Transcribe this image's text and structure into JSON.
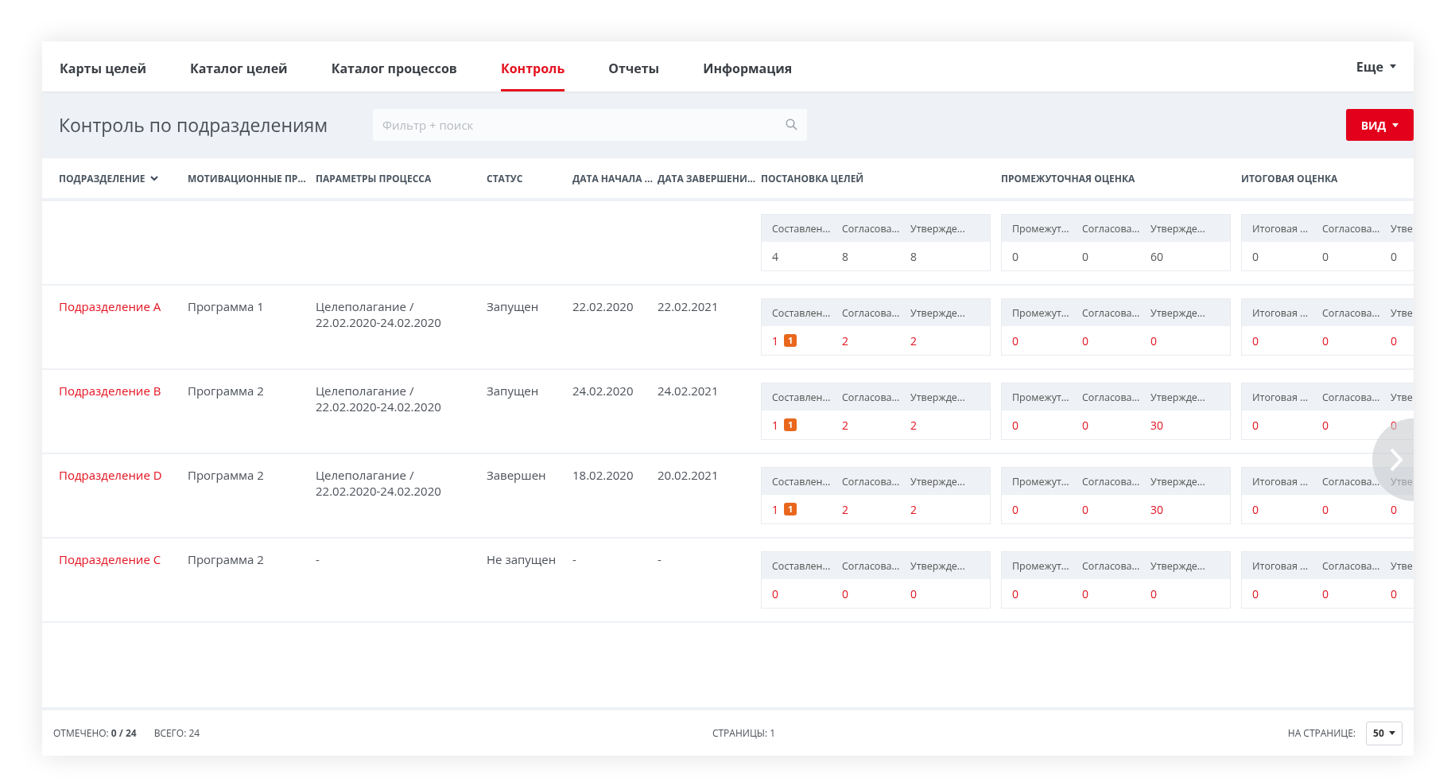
{
  "tabs": [
    {
      "label": "Карты целей",
      "selected": false
    },
    {
      "label": "Каталог целей",
      "selected": false
    },
    {
      "label": "Каталог процессов",
      "selected": false
    },
    {
      "label": "Контроль",
      "selected": true
    },
    {
      "label": "Отчеты",
      "selected": false
    },
    {
      "label": "Информация",
      "selected": false
    }
  ],
  "more_menu": "Еще",
  "title": "Контроль по подразделениям",
  "search": {
    "placeholder": "Фильтр + поиск"
  },
  "view_button": "ВИД",
  "columns": [
    {
      "label": "ПОДРАЗДЕЛЕНИЕ",
      "sorted": true
    },
    {
      "label": "МОТИВАЦИОННЫЕ ПР...",
      "sorted": false
    },
    {
      "label": "ПАРАМЕТРЫ ПРОЦЕССА",
      "sorted": false
    },
    {
      "label": "СТАТУС",
      "sorted": false
    },
    {
      "label": "ДАТА НАЧАЛА ...",
      "sorted": false
    },
    {
      "label": "ДАТА ЗАВЕРШЕНИ...",
      "sorted": false
    },
    {
      "label": "ПОСТАНОВКА ЦЕЛЕЙ",
      "sorted": false
    },
    {
      "label": "ПРОМЕЖУТОЧНАЯ ОЦЕНКА",
      "sorted": false
    },
    {
      "label": "ИТОГОВАЯ ОЦЕНКА",
      "sorted": false
    }
  ],
  "summary": [
    {
      "headers": [
        "Составлен...",
        "Согласова...",
        "Утвержде..."
      ],
      "values": [
        {
          "text": "4"
        },
        {
          "text": "8"
        },
        {
          "text": "8"
        }
      ]
    },
    {
      "headers": [
        "Промежут...",
        "Согласова...",
        "Утвержде..."
      ],
      "values": [
        {
          "text": "0"
        },
        {
          "text": "0"
        },
        {
          "text": "60"
        }
      ]
    },
    {
      "headers": [
        "Итоговая ...",
        "Согласова...",
        "Утве"
      ],
      "values": [
        {
          "text": "0"
        },
        {
          "text": "0"
        },
        {
          "text": "0"
        }
      ]
    }
  ],
  "rows": [
    {
      "division": "Подразделение A",
      "program": "Программа 1",
      "params": [
        "Целеполагание /",
        "22.02.2020-24.02.2020"
      ],
      "status": "Запущен",
      "start": "22.02.2020",
      "end": "22.02.2021",
      "groups": [
        {
          "headers": [
            "Составлен...",
            "Согласова...",
            "Утвержде..."
          ],
          "values": [
            {
              "text": "1",
              "badge": "1"
            },
            {
              "text": "2"
            },
            {
              "text": "2"
            }
          ]
        },
        {
          "headers": [
            "Промежут...",
            "Согласова...",
            "Утвержде..."
          ],
          "values": [
            {
              "text": "0"
            },
            {
              "text": "0"
            },
            {
              "text": "0"
            }
          ]
        },
        {
          "headers": [
            "Итоговая ...",
            "Согласова...",
            "Утве"
          ],
          "values": [
            {
              "text": "0"
            },
            {
              "text": "0"
            },
            {
              "text": "0"
            }
          ]
        }
      ]
    },
    {
      "division": "Подразделение B",
      "program": "Программа 2",
      "params": [
        "Целеполагание /",
        "22.02.2020-24.02.2020"
      ],
      "status": "Запущен",
      "start": "24.02.2020",
      "end": "24.02.2021",
      "groups": [
        {
          "headers": [
            "Составлен...",
            "Согласова...",
            "Утвержде..."
          ],
          "values": [
            {
              "text": "1",
              "badge": "1"
            },
            {
              "text": "2"
            },
            {
              "text": "2"
            }
          ]
        },
        {
          "headers": [
            "Промежут...",
            "Согласова...",
            "Утвержде..."
          ],
          "values": [
            {
              "text": "0"
            },
            {
              "text": "0"
            },
            {
              "text": "30"
            }
          ]
        },
        {
          "headers": [
            "Итоговая ...",
            "Согласова...",
            "Утве"
          ],
          "values": [
            {
              "text": "0"
            },
            {
              "text": "0"
            },
            {
              "text": "0"
            }
          ]
        }
      ]
    },
    {
      "division": "Подразделение D",
      "program": "Программа 2",
      "params": [
        "Целеполагание /",
        "22.02.2020-24.02.2020"
      ],
      "status": "Завершен",
      "start": "18.02.2020",
      "end": "20.02.2021",
      "groups": [
        {
          "headers": [
            "Составлен...",
            "Согласова...",
            "Утвержде..."
          ],
          "values": [
            {
              "text": "1",
              "badge": "1"
            },
            {
              "text": "2"
            },
            {
              "text": "2"
            }
          ]
        },
        {
          "headers": [
            "Промежут...",
            "Согласова...",
            "Утвержде..."
          ],
          "values": [
            {
              "text": "0"
            },
            {
              "text": "0"
            },
            {
              "text": "30"
            }
          ]
        },
        {
          "headers": [
            "Итоговая ...",
            "Согласова...",
            "Утве"
          ],
          "values": [
            {
              "text": "0"
            },
            {
              "text": "0"
            },
            {
              "text": "0"
            }
          ]
        }
      ]
    },
    {
      "division": "Подразделение C",
      "program": "Программа 2",
      "params": [
        "-"
      ],
      "status": "Не запущен",
      "start": "-",
      "end": "-",
      "groups": [
        {
          "headers": [
            "Составлен...",
            "Согласова...",
            "Утвержде..."
          ],
          "values": [
            {
              "text": "0"
            },
            {
              "text": "0"
            },
            {
              "text": "0"
            }
          ]
        },
        {
          "headers": [
            "Промежут...",
            "Согласова...",
            "Утвержде..."
          ],
          "values": [
            {
              "text": "0"
            },
            {
              "text": "0"
            },
            {
              "text": "0"
            }
          ]
        },
        {
          "headers": [
            "Итоговая ...",
            "Согласова...",
            "Утве"
          ],
          "values": [
            {
              "text": "0"
            },
            {
              "text": "0"
            },
            {
              "text": "0"
            }
          ]
        }
      ]
    }
  ],
  "footer": {
    "checked": "ОТМЕЧЕНО: **0 / 24**",
    "total": "ВСЕГО: 24",
    "pages": "СТРАНИЦЫ: 1",
    "per_page_label": "НА СТРАНИЦЕ:",
    "per_page": "50"
  }
}
